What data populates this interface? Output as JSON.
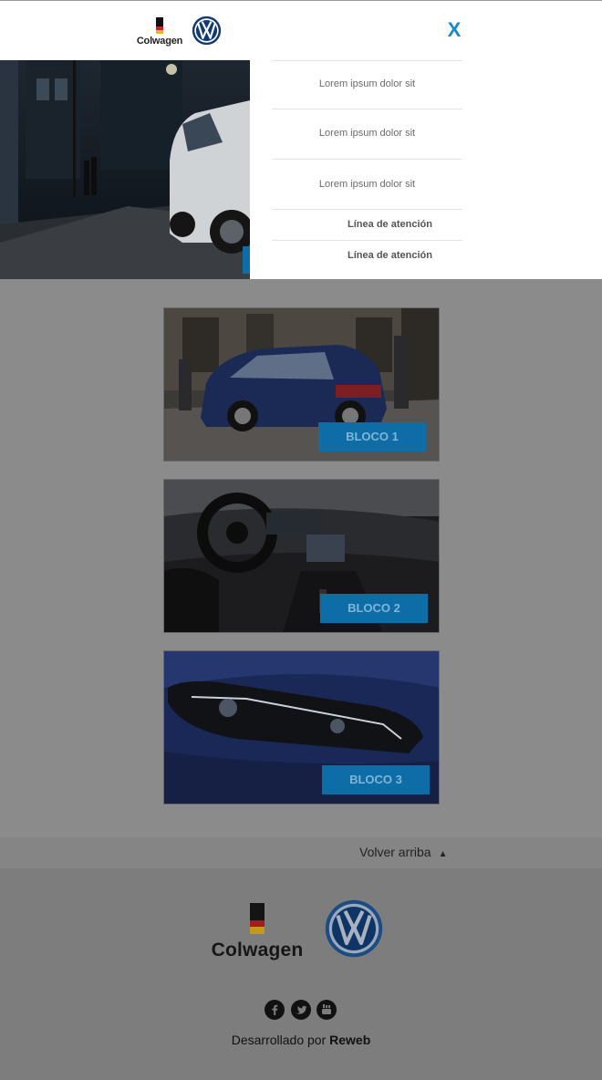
{
  "header": {
    "brand": "Colwagen",
    "close_label": "X"
  },
  "menu": {
    "items": [
      {
        "label": "Lorem ipsum dolor sit",
        "style": "normal"
      },
      {
        "label": "Lorem ipsum dolor sit",
        "style": "normal"
      },
      {
        "label": "Lorem ipsum dolor sit",
        "style": "normal"
      },
      {
        "label": "Línea de atención",
        "style": "bold"
      },
      {
        "label": "Línea de atención",
        "style": "bold"
      }
    ]
  },
  "blocks": [
    {
      "label": "BLOCO 1",
      "image": "blue-hatchback-street"
    },
    {
      "label": "BLOCO 2",
      "image": "car-interior-dashboard"
    },
    {
      "label": "BLOCO 3",
      "image": "headlight-closeup"
    }
  ],
  "footer": {
    "back_to_top": "Volver arriba",
    "brand": "Colwagen",
    "developed_by": "Desarrollado por",
    "developer": "Reweb",
    "social": [
      "facebook-icon",
      "twitter-icon",
      "youtube-icon"
    ]
  },
  "colors": {
    "accent": "#1a8ac8",
    "button": "#0e6da6",
    "overlay": "#8b8b8b"
  }
}
